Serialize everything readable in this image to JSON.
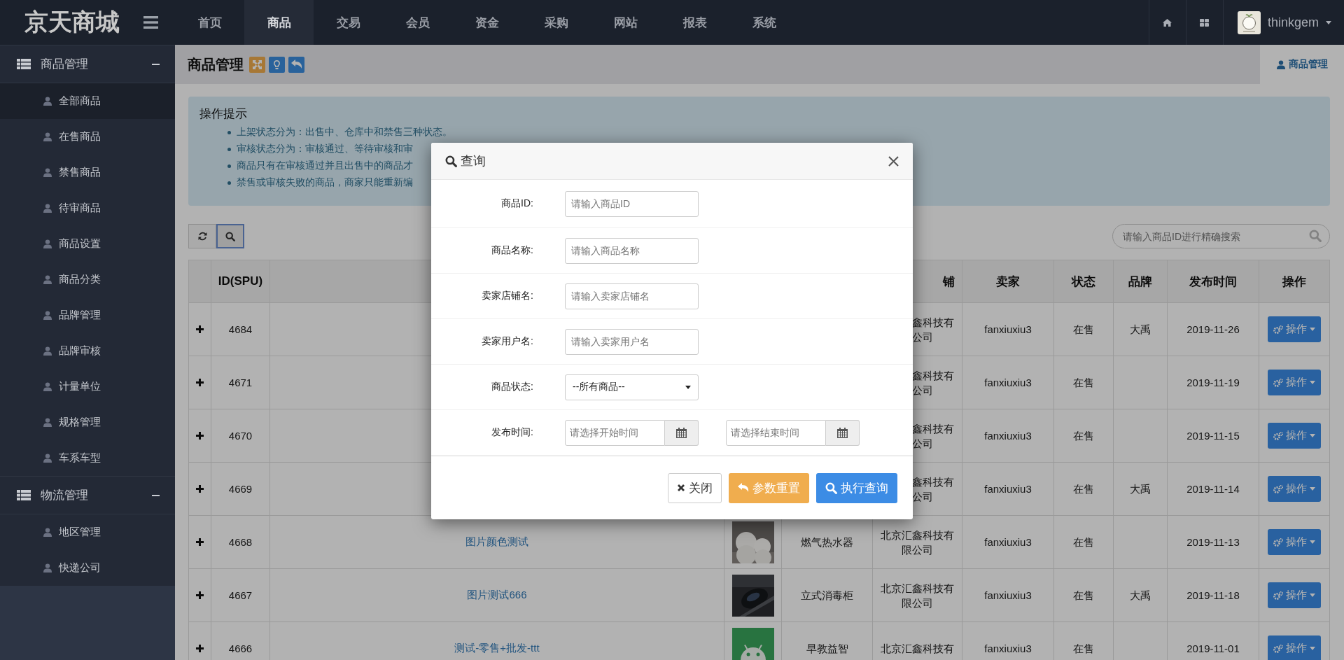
{
  "brand": {
    "logo": "京天商城"
  },
  "nav": [
    {
      "label": "首页",
      "selected": false
    },
    {
      "label": "商品",
      "selected": true
    },
    {
      "label": "交易",
      "selected": false
    },
    {
      "label": "会员",
      "selected": false
    },
    {
      "label": "资金",
      "selected": false
    },
    {
      "label": "采购",
      "selected": false
    },
    {
      "label": "网站",
      "selected": false
    },
    {
      "label": "报表",
      "selected": false
    },
    {
      "label": "系统",
      "selected": false
    }
  ],
  "user": {
    "name": "thinkgem"
  },
  "sidebar": [
    {
      "label": "商品管理",
      "expanded": true,
      "items": [
        {
          "label": "全部商品",
          "selected": true
        },
        {
          "label": "在售商品",
          "selected": false
        },
        {
          "label": "禁售商品",
          "selected": false
        },
        {
          "label": "待审商品",
          "selected": false
        },
        {
          "label": "商品设置",
          "selected": false
        },
        {
          "label": "商品分类",
          "selected": false
        },
        {
          "label": "品牌管理",
          "selected": false
        },
        {
          "label": "品牌审核",
          "selected": false
        },
        {
          "label": "计量单位",
          "selected": false
        },
        {
          "label": "规格管理",
          "selected": false
        },
        {
          "label": "车系车型",
          "selected": false
        }
      ]
    },
    {
      "label": "物流管理",
      "expanded": true,
      "items": [
        {
          "label": "地区管理",
          "selected": false
        },
        {
          "label": "快递公司",
          "selected": false
        }
      ]
    }
  ],
  "page": {
    "title": "商品管理",
    "tab": "商品管理"
  },
  "tips": {
    "title": "操作提示",
    "items": [
      "上架状态分为：出售中、仓库中和禁售三种状态。",
      "审核状态分为：审核通过、等待审核和审",
      "商品只有在审核通过并且出售中的商品才",
      "禁售或审核失败的商品，商家只能重新编"
    ]
  },
  "toolbar": [
    {
      "kind": "refresh",
      "active": false
    },
    {
      "kind": "search",
      "active": true
    }
  ],
  "search": {
    "placeholder": "请输入商品ID进行精确搜索"
  },
  "table": {
    "header": {
      "id": "ID(SPU)",
      "store": "铺",
      "seller": "卖家",
      "status": "状态",
      "brand": "品牌",
      "date": "发布时间",
      "action": "操作"
    },
    "rows": [
      {
        "id": "4684",
        "store": "鑫科技有公司",
        "seller": "fanxiuxiu3",
        "status": "在售",
        "brand": "大禹",
        "date": "2019-11-26",
        "action": "操作"
      },
      {
        "id": "4671",
        "store": "鑫科技有公司",
        "seller": "fanxiuxiu3",
        "status": "在售",
        "date": "2019-11-19",
        "action": "操作"
      },
      {
        "id": "4670",
        "store": "鑫科技有公司",
        "seller": "fanxiuxiu3",
        "status": "在售",
        "date": "2019-11-15",
        "action": "操作"
      },
      {
        "id": "4669",
        "store": "鑫科技有公司",
        "seller": "fanxiuxiu3",
        "status": "在售",
        "brand": "大禹",
        "date": "2019-11-14",
        "action": "操作"
      },
      {
        "id": "4668",
        "name": "图片颜色测试",
        "category": "燃气热水器",
        "store": "北京汇鑫科技有限公司",
        "seller": "fanxiuxiu3",
        "status": "在售",
        "date": "2019-11-13",
        "action": "操作"
      },
      {
        "id": "4667",
        "name": "图片测试666",
        "category": "立式消毒柜",
        "store": "北京汇鑫科技有限公司",
        "seller": "fanxiuxiu3",
        "status": "在售",
        "brand": "大禹",
        "date": "2019-11-18",
        "action": "操作"
      },
      {
        "id": "4666",
        "name": "测试-零售+批发-ttt",
        "category": "早教益智",
        "store": "北京汇鑫科技有",
        "seller": "fanxiuxiu3",
        "status": "在售",
        "date": "2019-11-01",
        "action": "操作"
      }
    ]
  },
  "dialog": {
    "title": "查询",
    "fields": [
      {
        "kind": "text",
        "label": "商品ID:",
        "placeholder": "请输入商品ID"
      },
      {
        "kind": "text",
        "label": "商品名称:",
        "placeholder": "请输入商品名称"
      },
      {
        "kind": "text",
        "label": "卖家店铺名:",
        "placeholder": "请输入卖家店铺名"
      },
      {
        "kind": "text",
        "label": "卖家用户名:",
        "placeholder": "请输入卖家用户名"
      },
      {
        "kind": "select",
        "label": "商品状态:",
        "value": "--所有商品--"
      },
      {
        "kind": "daterange",
        "label": "发布时间:",
        "placeholder": "请选择开始时间",
        "placeholder_end": "请选择结束时间"
      }
    ],
    "buttons": [
      {
        "kind": "default",
        "label": "关闭"
      },
      {
        "kind": "warning",
        "label": "参数重置"
      },
      {
        "kind": "primary",
        "label": "执行查询"
      }
    ]
  }
}
